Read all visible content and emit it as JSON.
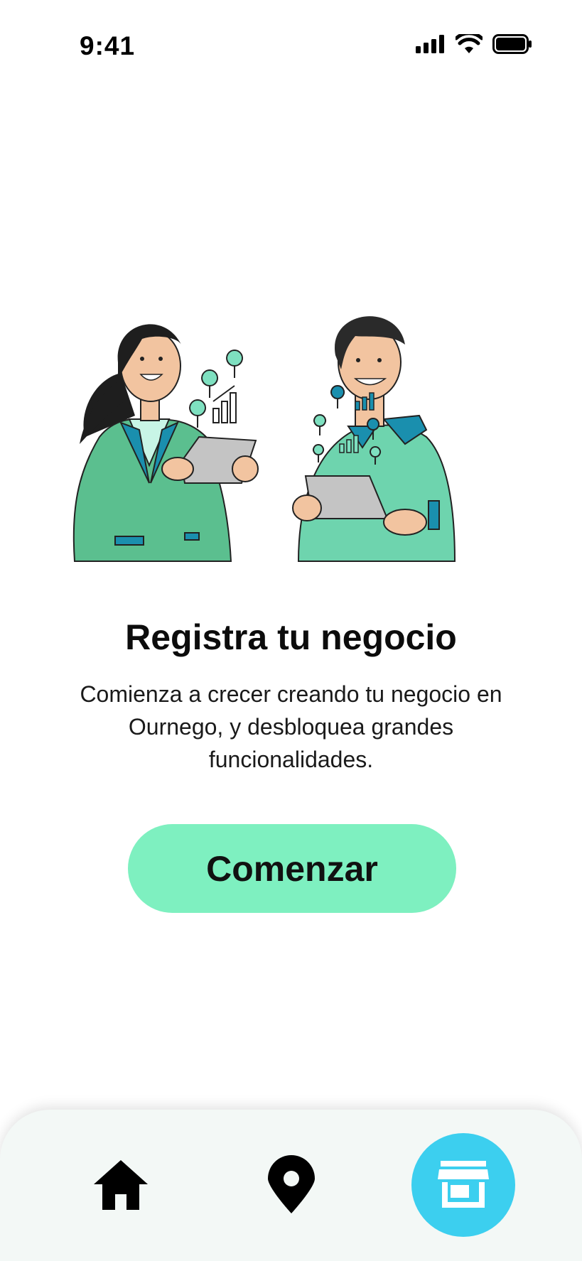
{
  "status_bar": {
    "time": "9:41"
  },
  "main": {
    "title": "Registra tu negocio",
    "subtitle": "Comienza a crecer creando tu negocio en Ournego, y desbloquea grandes funcionalidades.",
    "cta_label": "Comenzar"
  },
  "bottom_nav": {
    "items": [
      {
        "name": "home",
        "icon": "home-icon",
        "active": false
      },
      {
        "name": "map",
        "icon": "location-pin-icon",
        "active": false
      },
      {
        "name": "store",
        "icon": "store-icon",
        "active": true
      }
    ]
  },
  "colors": {
    "cta_bg": "#7ef0c0",
    "active_nav_bg": "#3ccfef",
    "nav_bg": "#f3f8f6",
    "jacket": "#5bbf8f",
    "accent_teal": "#1a8fae"
  }
}
